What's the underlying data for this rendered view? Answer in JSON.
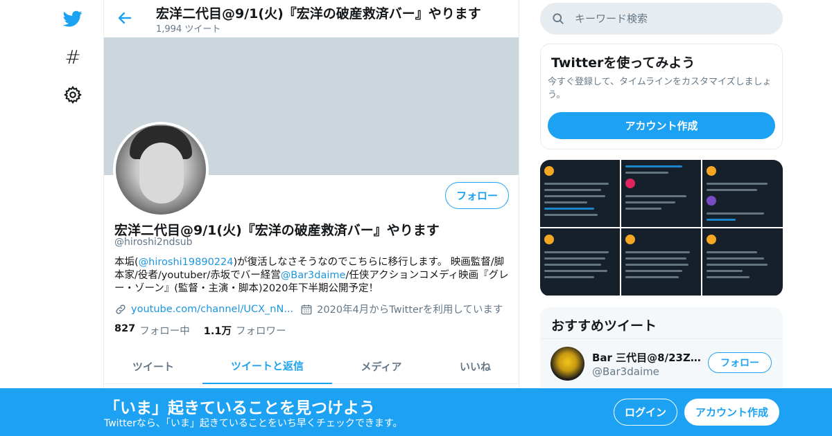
{
  "nav": {
    "icons": [
      "twitter-logo-icon",
      "hashtag-icon",
      "gear-icon"
    ],
    "explore_glyph": "#"
  },
  "header": {
    "title": "宏洋二代目@9/1(火)『宏洋の破産救済バー』やります",
    "tweet_count": "1,994 ツイート"
  },
  "profile": {
    "name": "宏洋二代目@9/1(火)『宏洋の破産救済バー』やります",
    "handle": "@hiroshi2ndsub",
    "follow_label": "フォロー",
    "bio": {
      "part1": "本垢(",
      "mention1": "@hiroshi19890224",
      "part2": ")が復活しなさそうなのでこちらに移行します。 映画監督/脚本家/役者/youtuber/赤坂でバー経営",
      "mention2": "@Bar3daime",
      "part3": "/任侠アクションコメディ映画『グレー・ゾーン』(監督・主演・脚本)2020年下半期公開予定！"
    },
    "link": "youtube.com/channel/UCX_nN...",
    "joined": "2020年4月からTwitterを利用しています",
    "following_count": "827",
    "following_label": "フォロー中",
    "followers_count": "1.1万",
    "followers_label": "フォロワー"
  },
  "tabs": [
    {
      "label": "ツイート",
      "active": false
    },
    {
      "label": "ツイートと返信",
      "active": true
    },
    {
      "label": "メディア",
      "active": false
    },
    {
      "label": "いいね",
      "active": false
    }
  ],
  "search": {
    "placeholder": "キーワード検索"
  },
  "signup_card": {
    "title": "Twitterを使ってみよう",
    "description": "今すぐ登録して、タイムラインをカスタマイズしましょう。",
    "button": "アカウント作成"
  },
  "recommended": {
    "title": "おすすめツイート",
    "name": "Bar 三代目@8/23ZIC...",
    "handle": "@Bar3daime",
    "follow_label": "フォロー"
  },
  "bottom_bar": {
    "title": "「いま」起きていることを見つけよう",
    "subtitle": "Twitterなら、「いま」起きていることをいち早くチェックできます。",
    "login": "ログイン",
    "signup": "アカウント作成"
  },
  "colors": {
    "accent": "#1da1f2",
    "text": "#14171a",
    "muted": "#657786",
    "banner": "#ccd6dd",
    "dark_thumb": "#15202b"
  }
}
